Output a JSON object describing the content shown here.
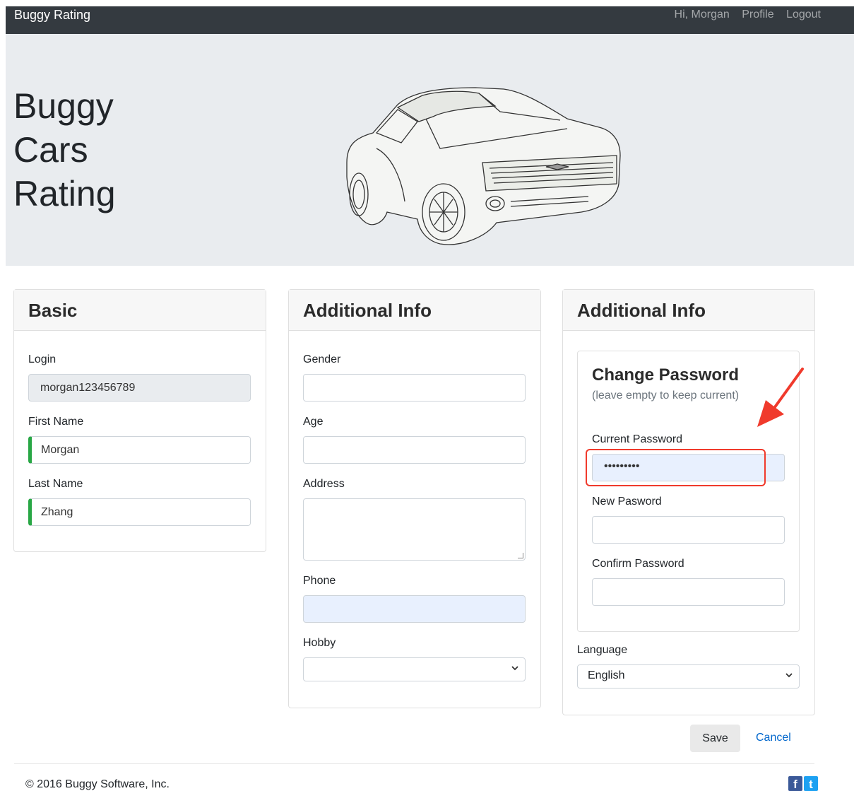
{
  "nav": {
    "brand": "Buggy Rating",
    "greeting": "Hi, Morgan",
    "profile": "Profile",
    "logout": "Logout"
  },
  "hero": {
    "title_line1": "Buggy",
    "title_line2": "Cars",
    "title_line3": "Rating"
  },
  "basic": {
    "header": "Basic",
    "login_label": "Login",
    "login_value": "morgan123456789",
    "first_name_label": "First Name",
    "first_name_value": "Morgan",
    "last_name_label": "Last Name",
    "last_name_value": "Zhang"
  },
  "additional": {
    "header": "Additional Info",
    "gender_label": "Gender",
    "gender_value": "",
    "age_label": "Age",
    "age_value": "",
    "address_label": "Address",
    "address_value": "",
    "phone_label": "Phone",
    "phone_value": "",
    "hobby_label": "Hobby",
    "hobby_value": ""
  },
  "password_section": {
    "header": "Additional Info",
    "title": "Change Password",
    "subtitle": "(leave empty to keep current)",
    "current_label": "Current Password",
    "current_value": "•••••••••",
    "new_label": "New Pasword",
    "confirm_label": "Confirm Password",
    "language_label": "Language",
    "language_value": "English"
  },
  "actions": {
    "save": "Save",
    "cancel": "Cancel"
  },
  "footer": {
    "copyright": "© 2016 Buggy Software, Inc.",
    "facebook_glyph": "f",
    "twitter_glyph": "t"
  },
  "colors": {
    "navbar": "#343a40",
    "hero": "#e9ecef",
    "valid": "#28a745",
    "annotation": "#f03a2c",
    "link": "#0066cc"
  }
}
